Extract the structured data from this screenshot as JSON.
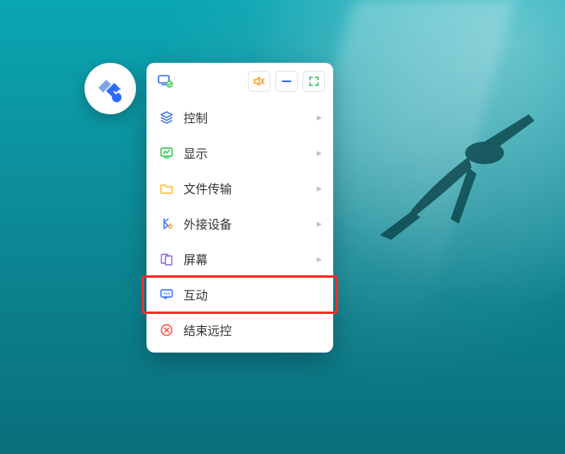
{
  "colors": {
    "accent_blue": "#2f6bff",
    "accent_green": "#2bbf4e",
    "accent_orange": "#ff9a1f",
    "accent_purple": "#8a5cf0",
    "danger": "#ff4b3e"
  },
  "topbar": {
    "status_icon_name": "monitor-connected-icon",
    "mute_icon_name": "speaker-mute-icon",
    "minimize_icon_name": "minimize-icon",
    "fullscreen_icon_name": "fullscreen-brackets-icon"
  },
  "menu": {
    "items": [
      {
        "icon": "layers-icon",
        "label": "控制",
        "has_submenu": true,
        "highlight": false
      },
      {
        "icon": "monitor-chart-icon",
        "label": "显示",
        "has_submenu": true,
        "highlight": false
      },
      {
        "icon": "folder-icon",
        "label": "文件传输",
        "has_submenu": true,
        "highlight": false
      },
      {
        "icon": "bluetooth-peripheral-icon",
        "label": "外接设备",
        "has_submenu": true,
        "highlight": false
      },
      {
        "icon": "multi-screen-icon",
        "label": "屏幕",
        "has_submenu": true,
        "highlight": false
      },
      {
        "icon": "chat-monitor-icon",
        "label": "互动",
        "has_submenu": false,
        "highlight": true
      },
      {
        "icon": "close-circle-icon",
        "label": "结束远控",
        "has_submenu": false,
        "highlight": false,
        "danger": true
      }
    ]
  }
}
